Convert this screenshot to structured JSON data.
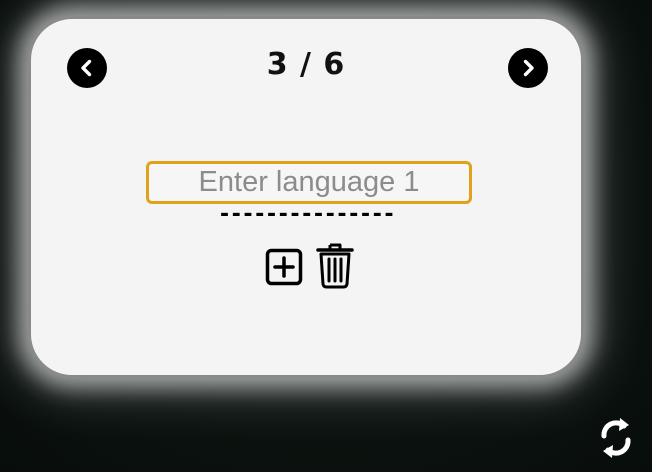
{
  "card": {
    "counter": "3 / 6",
    "input": {
      "placeholder": "Enter language 1",
      "value": ""
    },
    "separator": "---------------"
  },
  "icons": {
    "prev": "chevron-left-icon",
    "next": "chevron-right-icon",
    "add": "plus-square-icon",
    "delete": "trash-icon",
    "refresh": "refresh-icon"
  },
  "colors": {
    "input_border": "#e0a21a",
    "card_background": "#f4f4f4",
    "page_background": "#0c1411"
  }
}
